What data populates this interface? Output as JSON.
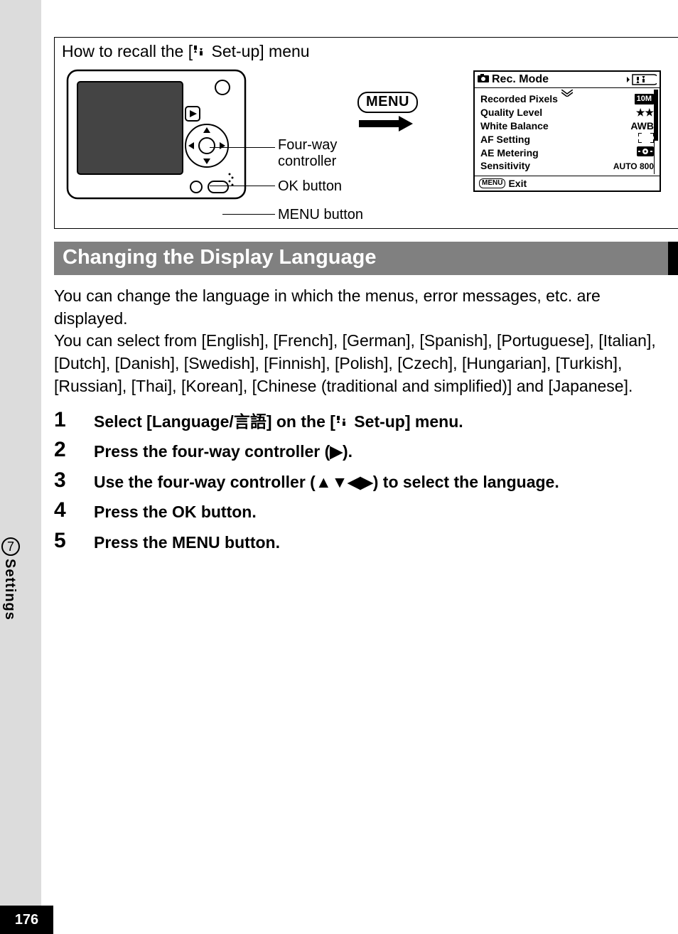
{
  "page_number": "176",
  "side_tab": {
    "number": "7",
    "label": "Settings"
  },
  "recall": {
    "title_prefix": "How to recall the [",
    "title_suffix": " Set-up] menu",
    "callouts": {
      "four_way": "Four-way\ncontroller",
      "ok_button": "OK button",
      "menu_button": "MENU button"
    },
    "menu_badge": "MENU"
  },
  "rec_panel": {
    "header_icon_label": "Rec. Mode",
    "rows": [
      {
        "label": "Recorded Pixels",
        "value_chip": "10M"
      },
      {
        "label": "Quality Level",
        "value": "★★"
      },
      {
        "label": "White Balance",
        "value": "AWB"
      },
      {
        "label": "AF Setting",
        "value_brackets": true
      },
      {
        "label": "AE Metering",
        "value_meter": true
      },
      {
        "label": "Sensitivity",
        "value": "AUTO 800"
      }
    ],
    "footer_chip": "MENU",
    "footer_label": "Exit"
  },
  "section_title": "Changing the Display Language",
  "intro": "You can change the language in which the menus, error messages, etc. are displayed.\nYou can select from [English], [French], [German], [Spanish], [Portuguese], [Italian], [Dutch], [Danish], [Swedish], [Finnish], [Polish], [Czech], [Hungarian], [Turkish], [Russian], [Thai], [Korean], [Chinese (traditional and simplified)] and [Japanese].",
  "steps": [
    {
      "n": "1",
      "text_pre": "Select [Language/",
      "text_mid_jp": "言語",
      "text_post": "] on the [",
      "text_suffix": " Set-up] menu."
    },
    {
      "n": "2",
      "text": "Press the four-way controller (▶)."
    },
    {
      "n": "3",
      "text": "Use the four-way controller (▲▼◀▶) to select the language."
    },
    {
      "n": "4",
      "text": "Press the OK button."
    },
    {
      "n": "5",
      "text": "Press the MENU button."
    }
  ]
}
